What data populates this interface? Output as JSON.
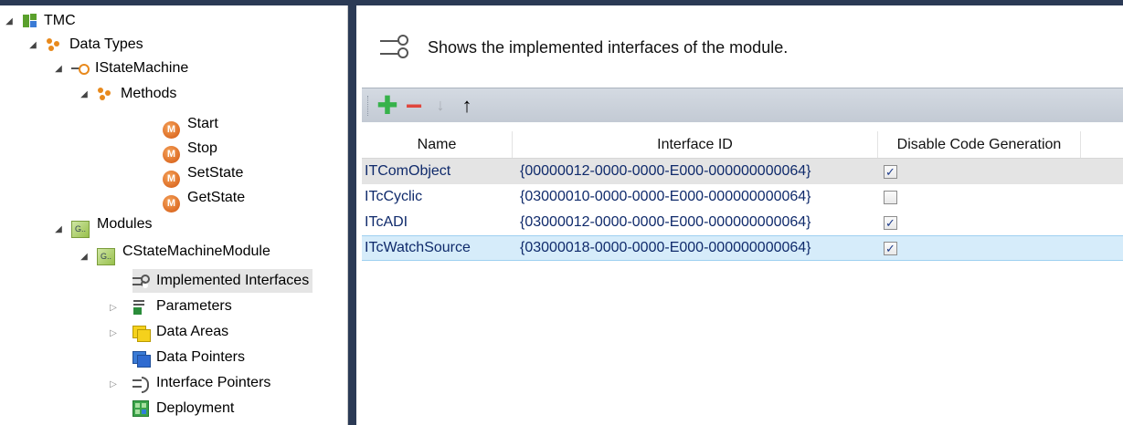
{
  "tree": {
    "root_label": "TMC",
    "data_types_label": "Data Types",
    "istatemachine_label": "IStateMachine",
    "methods_label": "Methods",
    "methods": [
      "Start",
      "Stop",
      "SetState",
      "GetState"
    ],
    "method_icon_letter": "M",
    "modules_label": "Modules",
    "module_label": "CStateMachineModule",
    "module_children": [
      "Implemented Interfaces",
      "Parameters",
      "Data Areas",
      "Data Pointers",
      "Interface Pointers",
      "Deployment"
    ],
    "module_icon_text": "G.."
  },
  "header": {
    "description": "Shows the implemented interfaces of the module."
  },
  "toolbar": {
    "add_glyph": "✚",
    "remove_glyph": "−",
    "down_glyph": "↓",
    "up_glyph": "↑"
  },
  "grid": {
    "columns": [
      "Name",
      "Interface ID",
      "Disable Code Generation"
    ],
    "rows": [
      {
        "name": "ITComObject",
        "iid": "{00000012-0000-0000-E000-000000000064}",
        "disabled": true,
        "checkmark": "✓"
      },
      {
        "name": "ITcCyclic",
        "iid": "{03000010-0000-0000-E000-000000000064}",
        "disabled": false,
        "checkmark": ""
      },
      {
        "name": "ITcADI",
        "iid": "{03000012-0000-0000-E000-000000000064}",
        "disabled": true,
        "checkmark": "✓"
      },
      {
        "name": "ITcWatchSource",
        "iid": "{03000018-0000-0000-E000-000000000064}",
        "disabled": true,
        "checkmark": "✓"
      }
    ]
  },
  "colors": {
    "frame": "#2b3a55",
    "selected_row": "#d6ecfa",
    "link_text": "#0f2a6b"
  }
}
